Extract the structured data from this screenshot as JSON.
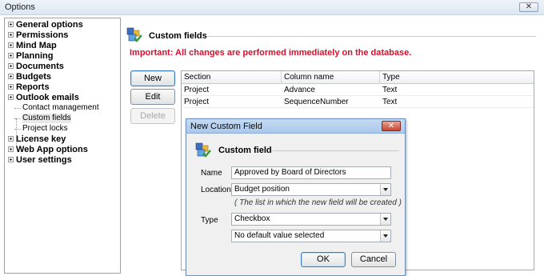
{
  "window": {
    "title": "Options",
    "close_glyph": "✕"
  },
  "tree": {
    "items": [
      {
        "label": "General options",
        "bold": true,
        "expandable": true
      },
      {
        "label": "Permissions",
        "bold": true,
        "expandable": true
      },
      {
        "label": "Mind Map",
        "bold": true,
        "expandable": true
      },
      {
        "label": "Planning",
        "bold": true,
        "expandable": true
      },
      {
        "label": "Documents",
        "bold": true,
        "expandable": true
      },
      {
        "label": "Budgets",
        "bold": true,
        "expandable": true
      },
      {
        "label": "Reports",
        "bold": true,
        "expandable": true
      },
      {
        "label": "Outlook emails",
        "bold": true,
        "expandable": true
      },
      {
        "label": "Contact management",
        "bold": false,
        "expandable": false
      },
      {
        "label": "Custom fields",
        "bold": false,
        "expandable": false,
        "selected": true
      },
      {
        "label": "Project locks",
        "bold": false,
        "expandable": false
      },
      {
        "label": "License key",
        "bold": true,
        "expandable": true
      },
      {
        "label": "Web App options",
        "bold": true,
        "expandable": true
      },
      {
        "label": "User settings",
        "bold": true,
        "expandable": true
      }
    ]
  },
  "main": {
    "section_title": "Custom fields",
    "important": "Important: All changes are performed immediately on the database.",
    "buttons": {
      "new": "New",
      "edit": "Edit",
      "delete": "Delete"
    },
    "table": {
      "columns": [
        "Section",
        "Column name",
        "Type"
      ],
      "rows": [
        [
          "Project",
          "Advance",
          "Text"
        ],
        [
          "Project",
          "SequenceNumber",
          "Text"
        ]
      ]
    }
  },
  "dialog": {
    "title": "New Custom Field",
    "close_glyph": "✕",
    "section_title": "Custom field",
    "name_label": "Name",
    "name_value": "Approved by Board of Directors",
    "location_label": "Location",
    "location_value": "Budget position",
    "location_hint": "( The list in which the new field will be created )",
    "type_label": "Type",
    "type_value": "Checkbox",
    "default_value": "No default value selected",
    "ok_label": "OK",
    "cancel_label": "Cancel"
  },
  "icons": {
    "custom_fields": "database-check-icon"
  },
  "colors": {
    "important": "#d4102c",
    "dialog_title_bg": "#a9c7ec"
  }
}
